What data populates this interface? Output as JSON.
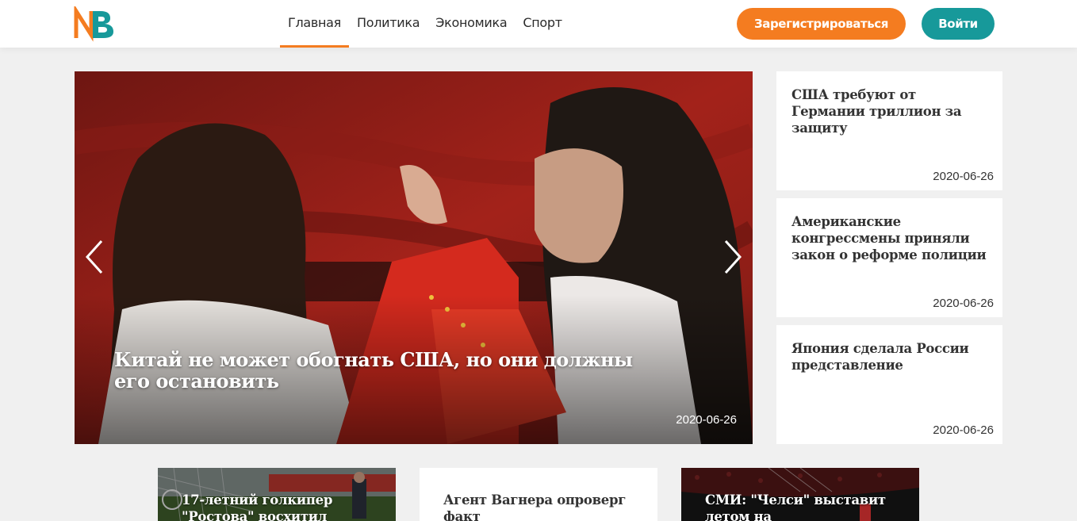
{
  "header": {
    "logo_text": "NB",
    "nav": [
      {
        "label": "Главная",
        "active": true
      },
      {
        "label": "Политика",
        "active": false
      },
      {
        "label": "Экономика",
        "active": false
      },
      {
        "label": "Спорт",
        "active": false
      }
    ],
    "register_label": "Зарегистрироваться",
    "login_label": "Войти"
  },
  "colors": {
    "accent_orange": "#f47c20",
    "accent_teal": "#17999a"
  },
  "hero": {
    "title": "Китай не может обогнать США, но они должны его остановить",
    "date": "2020-06-26",
    "prev_icon": "chevron-left-icon",
    "next_icon": "chevron-right-icon"
  },
  "side_news": [
    {
      "title": "США требуют от Германии триллион за защиту",
      "date": "2020-06-26"
    },
    {
      "title": "Американские конгрессмены приняли закон о реформе полиции",
      "date": "2020-06-26"
    },
    {
      "title": "Япония сделала России представление",
      "date": "2020-06-26"
    }
  ],
  "bottom_news": [
    {
      "title": "17-летний голкипер \"Ростова\" восхитил"
    },
    {
      "title": "Агент Вагнера опроверг факт"
    },
    {
      "title": "СМИ: \"Челси\" выставит летом на"
    }
  ]
}
